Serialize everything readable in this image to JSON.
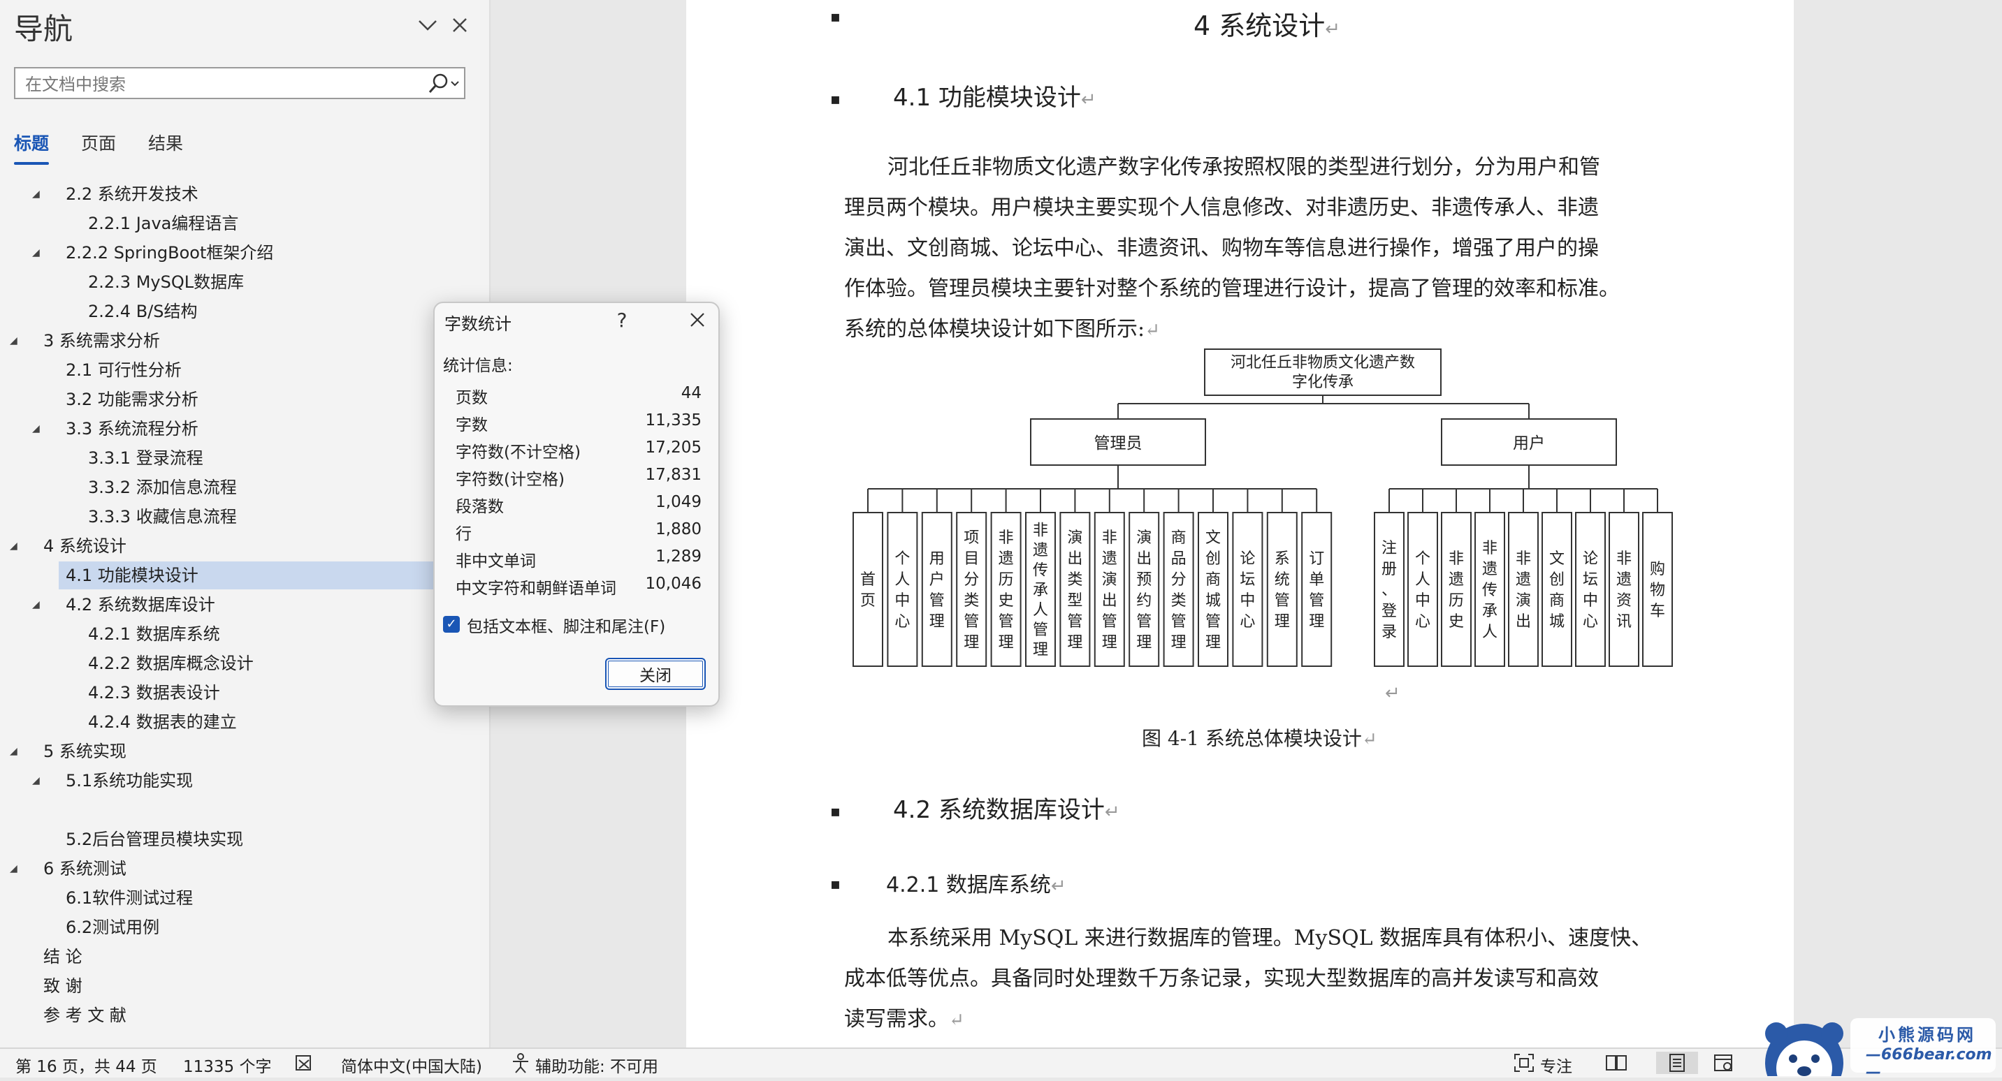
{
  "nav": {
    "title": "导航",
    "search_placeholder": "在文档中搜索",
    "tabs": [
      "标题",
      "页面",
      "结果"
    ],
    "tree": [
      {
        "label": "2.2 系统开发技术",
        "level": 1,
        "expanded": true
      },
      {
        "label": "2.2.1 Java编程语言",
        "level": 2
      },
      {
        "label": "2.2.2  SpringBoot框架介绍",
        "level": 1,
        "expanded": true
      },
      {
        "label": "2.2.3 MySQL数据库",
        "level": 2
      },
      {
        "label": "2.2.4 B/S结构",
        "level": 2
      },
      {
        "label": "3   系统需求分析",
        "level": 0,
        "expanded": true
      },
      {
        "label": "2.1 可行性分析",
        "level": 1
      },
      {
        "label": "3.2 功能需求分析",
        "level": 1
      },
      {
        "label": "3.3 系统流程分析",
        "level": 1,
        "expanded": true
      },
      {
        "label": "3.3.1  登录流程",
        "level": 2
      },
      {
        "label": "3.3.2  添加信息流程",
        "level": 2
      },
      {
        "label": "3.3.3  收藏信息流程",
        "level": 2
      },
      {
        "label": "4   系统设计",
        "level": 0,
        "expanded": true
      },
      {
        "label": "4.1 功能模块设计",
        "level": 1,
        "selected": true
      },
      {
        "label": "4.2 系统数据库设计",
        "level": 1,
        "expanded": true
      },
      {
        "label": "4.2.1  数据库系统",
        "level": 2
      },
      {
        "label": "4.2.2  数据库概念设计",
        "level": 2
      },
      {
        "label": "4.2.3  数据表设计",
        "level": 2
      },
      {
        "label": "4.2.4  数据表的建立",
        "level": 2
      },
      {
        "label": "5   系统实现",
        "level": 0,
        "expanded": true
      },
      {
        "label": "5.1系统功能实现",
        "level": 1,
        "expanded": true
      },
      {
        "label": "",
        "level": 1
      },
      {
        "label": "5.2后台管理员模块实现",
        "level": 1
      },
      {
        "label": "6   系统测试",
        "level": 0,
        "expanded": true
      },
      {
        "label": "6.1软件测试过程",
        "level": 1
      },
      {
        "label": "6.2测试用例",
        "level": 1
      },
      {
        "label": "结   论",
        "level": 0
      },
      {
        "label": "致   谢",
        "level": 0
      },
      {
        "label": "参 考 文 献",
        "level": 0
      }
    ]
  },
  "document": {
    "h1": "4   系统设计",
    "h2_1": "4.1  功能模块设计",
    "para1": [
      "河北任丘非物质文化遗产数字化传承按照权限的类型进行划分，分为用户和管",
      "理员两个模块。用户模块主要实现个人信息修改、对非遗历史、非遗传承人、非遗",
      "演出、文创商城、论坛中心、非遗资讯、购物车等信息进行操作，增强了用户的操",
      "作体验。管理员模块主要针对整个系统的管理进行设计，提高了管理的效率和标准。",
      "系统的总体模块设计如下图所示:"
    ],
    "diagram": {
      "root": "河北任丘非物质文化遗产数字化传承",
      "admin": {
        "label": "管理员",
        "children": [
          "首页",
          "个人中心",
          "用户管理",
          "项目分类管理",
          "非遗历史管理",
          "非遗传承人管理",
          "演出类型管理",
          "非遗演出管理",
          "演出预约管理",
          "商品分类管理",
          "文创商城管理",
          "论坛中心",
          "系统管理",
          "订单管理"
        ]
      },
      "user": {
        "label": "用户",
        "children": [
          "注册、登录",
          "个人中心",
          "非遗历史",
          "非遗传承人",
          "非遗演出",
          "文创商城",
          "论坛中心",
          "非遗资讯",
          "购物车"
        ]
      }
    },
    "caption": "图 4-1  系统总体模块设计",
    "h2_2": "4.2  系统数据库设计",
    "h3_1": "4.2.1  数据库系统",
    "para2": [
      "本系统采用 MySQL 来进行数据库的管理。MySQL 数据库具有体积小、速度快、",
      "成本低等优点。具备同时处理数千万条记录，实现大型数据库的高并发读写和高效",
      "读写需求。"
    ],
    "return_mark": "↵"
  },
  "dialog": {
    "title": "字数统计",
    "help": "?",
    "section_label": "统计信息:",
    "stats": [
      {
        "label": "页数",
        "value": "44"
      },
      {
        "label": "字数",
        "value": "11,335"
      },
      {
        "label": "字符数(不计空格)",
        "value": "17,205"
      },
      {
        "label": "字符数(计空格)",
        "value": "17,831"
      },
      {
        "label": "段落数",
        "value": "1,049"
      },
      {
        "label": "行",
        "value": "1,880"
      },
      {
        "label": "非中文单词",
        "value": "1,289"
      },
      {
        "label": "中文字符和朝鲜语单词",
        "value": "10,046"
      }
    ],
    "checkbox_label": "包括文本框、脚注和尾注(F)",
    "checkbox_checked": true,
    "close_label": "关闭"
  },
  "status": {
    "page": "第 16 页，共 44 页",
    "words": "11335 个字",
    "language": "简体中文(中国大陆)",
    "accessibility": "辅助功能: 不可用",
    "focus": "专注"
  },
  "logo": {
    "name": "小熊源码网",
    "url": "—666bear.com—"
  },
  "colors": {
    "accent": "#1a56b5",
    "selection": "#c9d8ee",
    "nav_bg": "#f3f3f3",
    "doc_bg": "#e8e8e8"
  }
}
